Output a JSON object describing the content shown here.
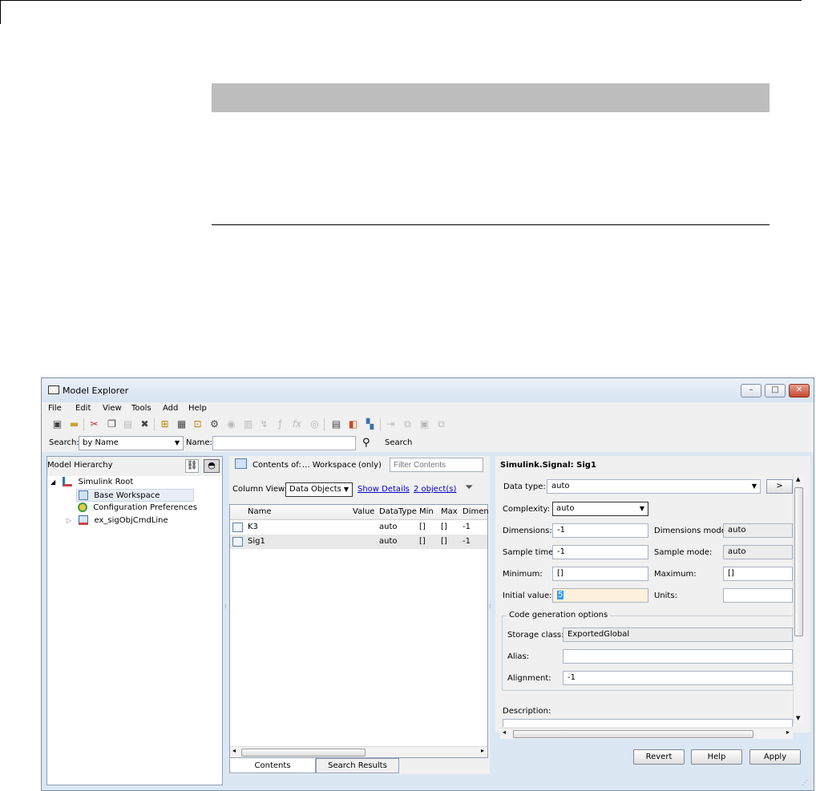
{
  "window": {
    "title": "Model Explorer",
    "controls": {
      "minimize": "–",
      "maximize": "□",
      "close": "✕"
    }
  },
  "menu": [
    "File",
    "Edit",
    "View",
    "Tools",
    "Add",
    "Help"
  ],
  "search": {
    "label": "Search:",
    "by_value": "by Name",
    "name_label": "Name:",
    "name_value": "",
    "button": "Search"
  },
  "hierarchy": {
    "title": "Model Hierarchy",
    "items": [
      "Simulink Root",
      "Base Workspace",
      "Configuration Preferences",
      "ex_sigObjCmdLine"
    ]
  },
  "contents": {
    "contents_of_label": "Contents of:",
    "contents_of_value": "... Workspace",
    "only_label": "(only)",
    "filter_placeholder": "Filter Contents",
    "column_view_label": "Column View:",
    "column_view_value": "Data Objects",
    "show_details": "Show Details",
    "object_count": "2 object(s)",
    "columns": [
      "Name",
      "Value",
      "DataType",
      "Min",
      "Max",
      "Dimen"
    ],
    "rows": [
      {
        "name": "K3",
        "value": "",
        "datatype": "auto",
        "min": "[]",
        "max": "[]",
        "dim": "-1"
      },
      {
        "name": "Sig1",
        "value": "",
        "datatype": "auto",
        "min": "[]",
        "max": "[]",
        "dim": "-1"
      }
    ],
    "tabs": [
      "Contents",
      "Search Results"
    ]
  },
  "dialog": {
    "title": "Simulink.Signal: Sig1",
    "data_type_label": "Data type:",
    "data_type_value": "auto",
    "data_type_button": ">",
    "complexity_label": "Complexity:",
    "complexity_value": "auto",
    "dimensions_label": "Dimensions:",
    "dimensions_value": "-1",
    "dimensions_mode_label": "Dimensions mode:",
    "dimensions_mode_value": "auto",
    "sample_time_label": "Sample time:",
    "sample_time_value": "-1",
    "sample_mode_label": "Sample mode:",
    "sample_mode_value": "auto",
    "minimum_label": "Minimum:",
    "minimum_value": "[]",
    "maximum_label": "Maximum:",
    "maximum_value": "[]",
    "initial_value_label": "Initial value:",
    "initial_value_value": "5",
    "units_label": "Units:",
    "units_value": "",
    "codegen_title": "Code generation options",
    "storage_class_label": "Storage class:",
    "storage_class_value": "ExportedGlobal",
    "alias_label": "Alias:",
    "alias_value": "",
    "alignment_label": "Alignment:",
    "alignment_value": "-1",
    "description_label": "Description:",
    "buttons": {
      "revert": "Revert",
      "help": "Help",
      "apply": "Apply"
    }
  },
  "colors": {
    "link": "#0000cc",
    "window_bg": "#dbe7f3",
    "panel_bg": "#f0f0f0",
    "close_button": "#c5472d"
  }
}
